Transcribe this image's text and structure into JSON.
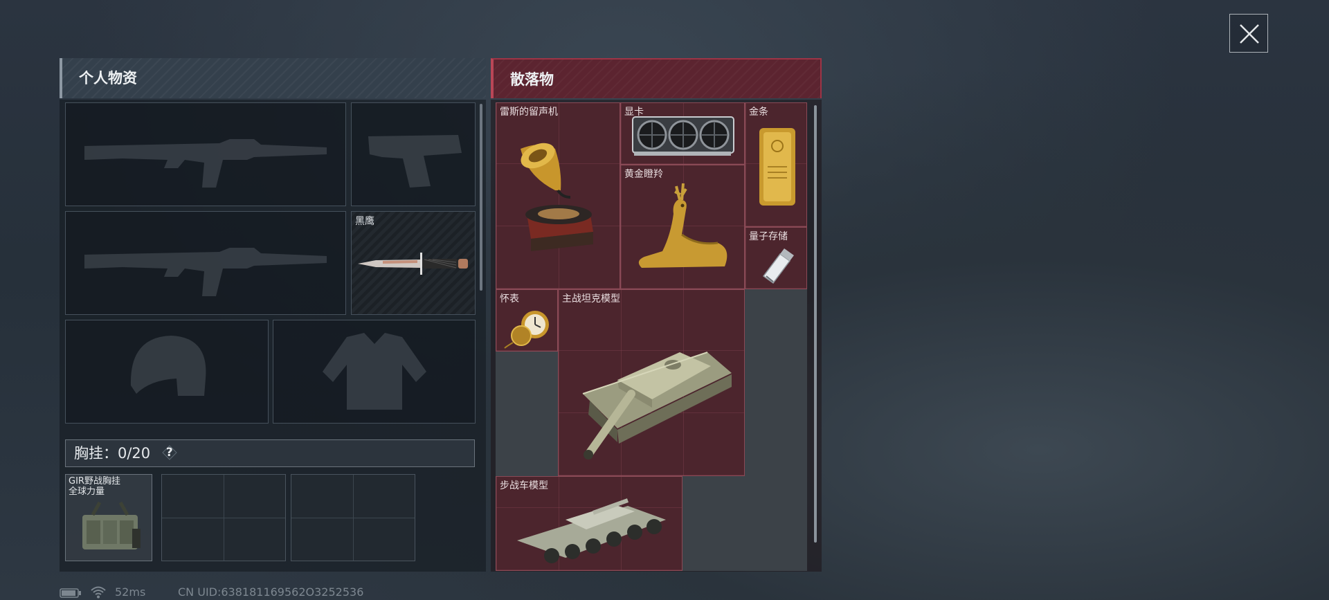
{
  "header": {
    "close_icon": "close-icon"
  },
  "personal": {
    "title": "个人物资",
    "knife_label": "黑鹰",
    "chest_rig_label": "胸挂：",
    "chest_rig_count": "0/20",
    "help_icon": "?",
    "rig_item_label": "GIR野战胸挂\n全球力量"
  },
  "loot": {
    "title": "散落物",
    "items": [
      {
        "label": "雷斯的留声机"
      },
      {
        "label": "显卡"
      },
      {
        "label": "金条"
      },
      {
        "label": "黄金瞪羚"
      },
      {
        "label": "量子存储"
      },
      {
        "label": "怀表"
      },
      {
        "label": "主战坦克模型"
      },
      {
        "label": "步战车模型"
      }
    ]
  },
  "status_bar": {
    "ping": "52ms",
    "uid": "CN UID:638181169562O3252536"
  },
  "colors": {
    "loot_accent": "#b94657",
    "personal_accent": "#8d98a3"
  }
}
